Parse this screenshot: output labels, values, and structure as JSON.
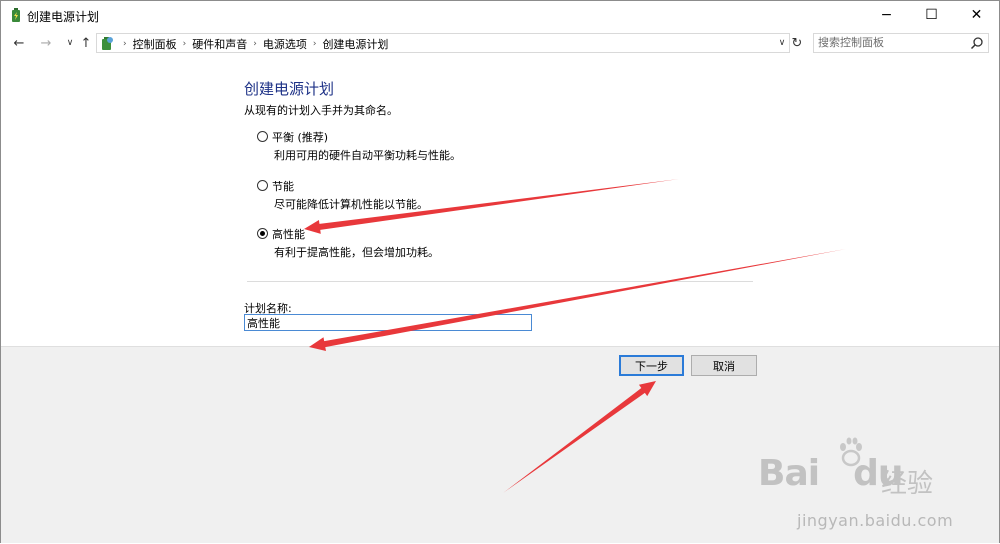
{
  "window": {
    "title": "创建电源计划",
    "icon": "power-options-icon",
    "minimize": "−",
    "maximize": "☐",
    "close": "✕"
  },
  "nav": {
    "back": "←",
    "forward": "→",
    "recent": "∨",
    "up": "↑",
    "breadcrumbs": [
      "控制面板",
      "硬件和声音",
      "电源选项",
      "创建电源计划"
    ],
    "separator": "›",
    "dropdown": "∨",
    "refresh": "↻",
    "search_placeholder": "搜索控制面板"
  },
  "content": {
    "heading": "创建电源计划",
    "subtitle": "从现有的计划入手并为其命名。",
    "options": [
      {
        "label": "平衡 (推荐)",
        "desc": "利用可用的硬件自动平衡功耗与性能。",
        "selected": false
      },
      {
        "label": "节能",
        "desc": "尽可能降低计算机性能以节能。",
        "selected": false
      },
      {
        "label": "高性能",
        "desc": "有利于提高性能，但会增加功耗。",
        "selected": true
      }
    ],
    "plan_name_label": "计划名称:",
    "plan_name_value": "高性能"
  },
  "buttons": {
    "next": "下一步",
    "cancel": "取消"
  },
  "annotations": {
    "arrow_color": "#e8383b"
  },
  "watermark": {
    "logo": "Bai",
    "logo2": "du",
    "cn": "经验",
    "url": "jingyan.baidu.com"
  }
}
